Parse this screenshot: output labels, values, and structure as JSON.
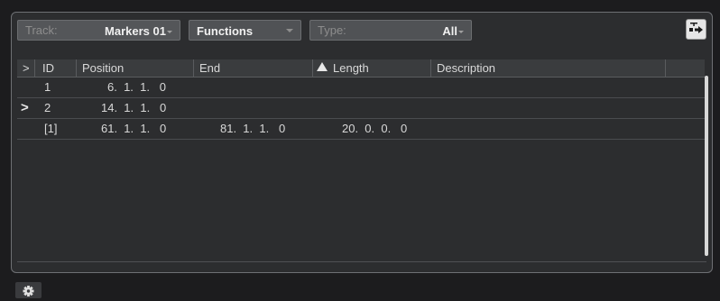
{
  "toolbar": {
    "track_label": "Track:",
    "track_value": "Markers 01",
    "functions_label": "Functions",
    "type_label": "Type:",
    "type_value": "All"
  },
  "table": {
    "columns": {
      "select": ">",
      "id": "ID",
      "position": "Position",
      "end": "End",
      "length": "Length",
      "description": "Description"
    },
    "rows": [
      {
        "arrow": "",
        "id": "1",
        "position": "6.  1.  1.   0",
        "end": "",
        "length": "",
        "description": ""
      },
      {
        "arrow": ">",
        "id": "2",
        "position": "14.  1.  1.   0",
        "end": "",
        "length": "",
        "description": ""
      },
      {
        "arrow": "",
        "id": "[1]",
        "position": "61.  1.  1.   0",
        "end": "81.  1.  1.   0",
        "length": "20.  0.  0.   0",
        "description": ""
      }
    ]
  },
  "icons": {
    "export": "export-icon",
    "settings": "gear-icon",
    "sort": "sort-ascending-icon"
  }
}
